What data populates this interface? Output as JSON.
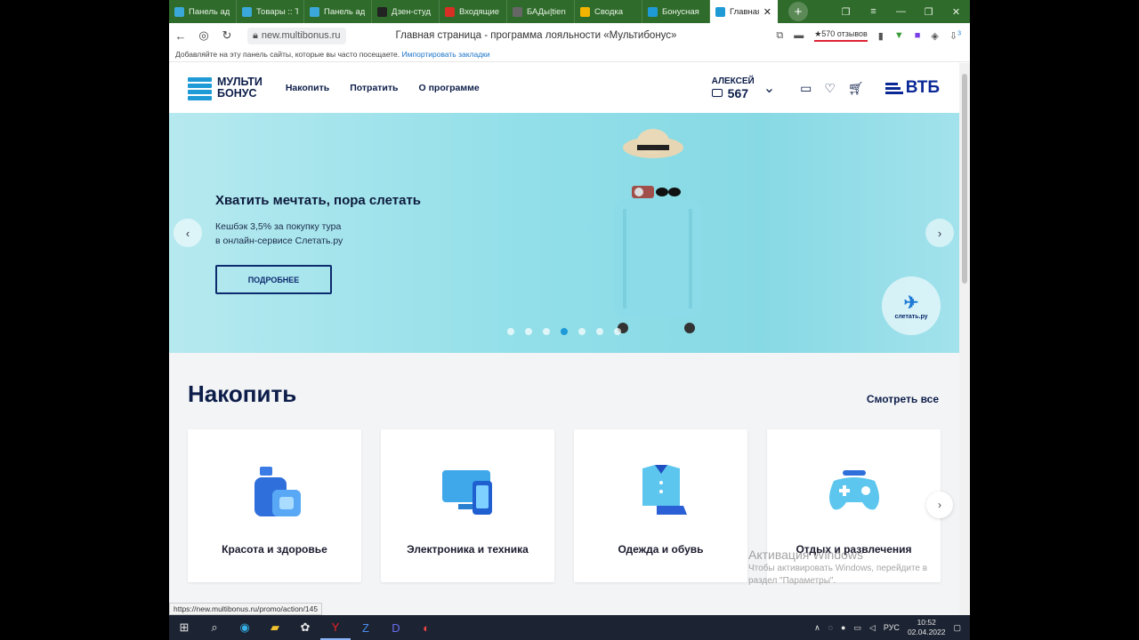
{
  "browser": {
    "tabs": [
      {
        "label": "Панель ад",
        "color": "#3aa8d8"
      },
      {
        "label": "Товары :: Т",
        "color": "#3aa8d8"
      },
      {
        "label": "Панель ад",
        "color": "#3aa8d8"
      },
      {
        "label": "Дзен-студ",
        "color": "#222222"
      },
      {
        "label": "Входящие",
        "color": "#d93025"
      },
      {
        "label": "БАДы|tien",
        "color": "#666666"
      },
      {
        "label": "Сводка",
        "color": "#f2b400"
      },
      {
        "label": "Бонусная",
        "color": "#1e9ad6"
      },
      {
        "label": "Главная",
        "color": "#1e9ad6",
        "active": true
      }
    ],
    "url": "new.multibonus.ru",
    "page_title": "Главная страница - программа лояльности «Мультибонус»",
    "reviews": "★570 отзывов",
    "bookmark_hint": "Добавляйте на эту панель сайты, которые вы часто посещаете.",
    "bookmark_import": "Импортировать закладки",
    "downloads_badge": "3"
  },
  "site": {
    "logo_line1": "МУЛЬТИ",
    "logo_line2": "БОНУС",
    "nav": [
      "Накопить",
      "Потратить",
      "О программе"
    ],
    "user_name": "АЛЕКСЕЙ",
    "user_points": "567",
    "bank_logo": "ВТБ"
  },
  "banner": {
    "title": "Хватить мечтать, пора слетать",
    "subtitle": "Кешбэк 3,5% за покупку тура\nв онлайн-сервисе Слетать.ру",
    "button": "ПОДРОБНЕЕ",
    "partner": "слетать.ру",
    "dots_total": 7,
    "dot_active": 4
  },
  "section": {
    "title": "Накопить",
    "see_all": "Смотреть все",
    "categories": [
      {
        "label": "Красота и здоровье",
        "icon": "cosmetics-icon"
      },
      {
        "label": "Электроника и техника",
        "icon": "devices-icon"
      },
      {
        "label": "Одежда и обувь",
        "icon": "clothes-icon"
      },
      {
        "label": "Отдых и развлечения",
        "icon": "gamepad-icon"
      }
    ]
  },
  "watermark": {
    "line1": "Активация Windows",
    "line2": "Чтобы активировать Windows, перейдите в",
    "line3": "раздел \"Параметры\"."
  },
  "status_url": "https://new.multibonus.ru/promo/action/145",
  "taskbar": {
    "lang": "РУС",
    "time": "10:52",
    "date": "02.04.2022"
  }
}
